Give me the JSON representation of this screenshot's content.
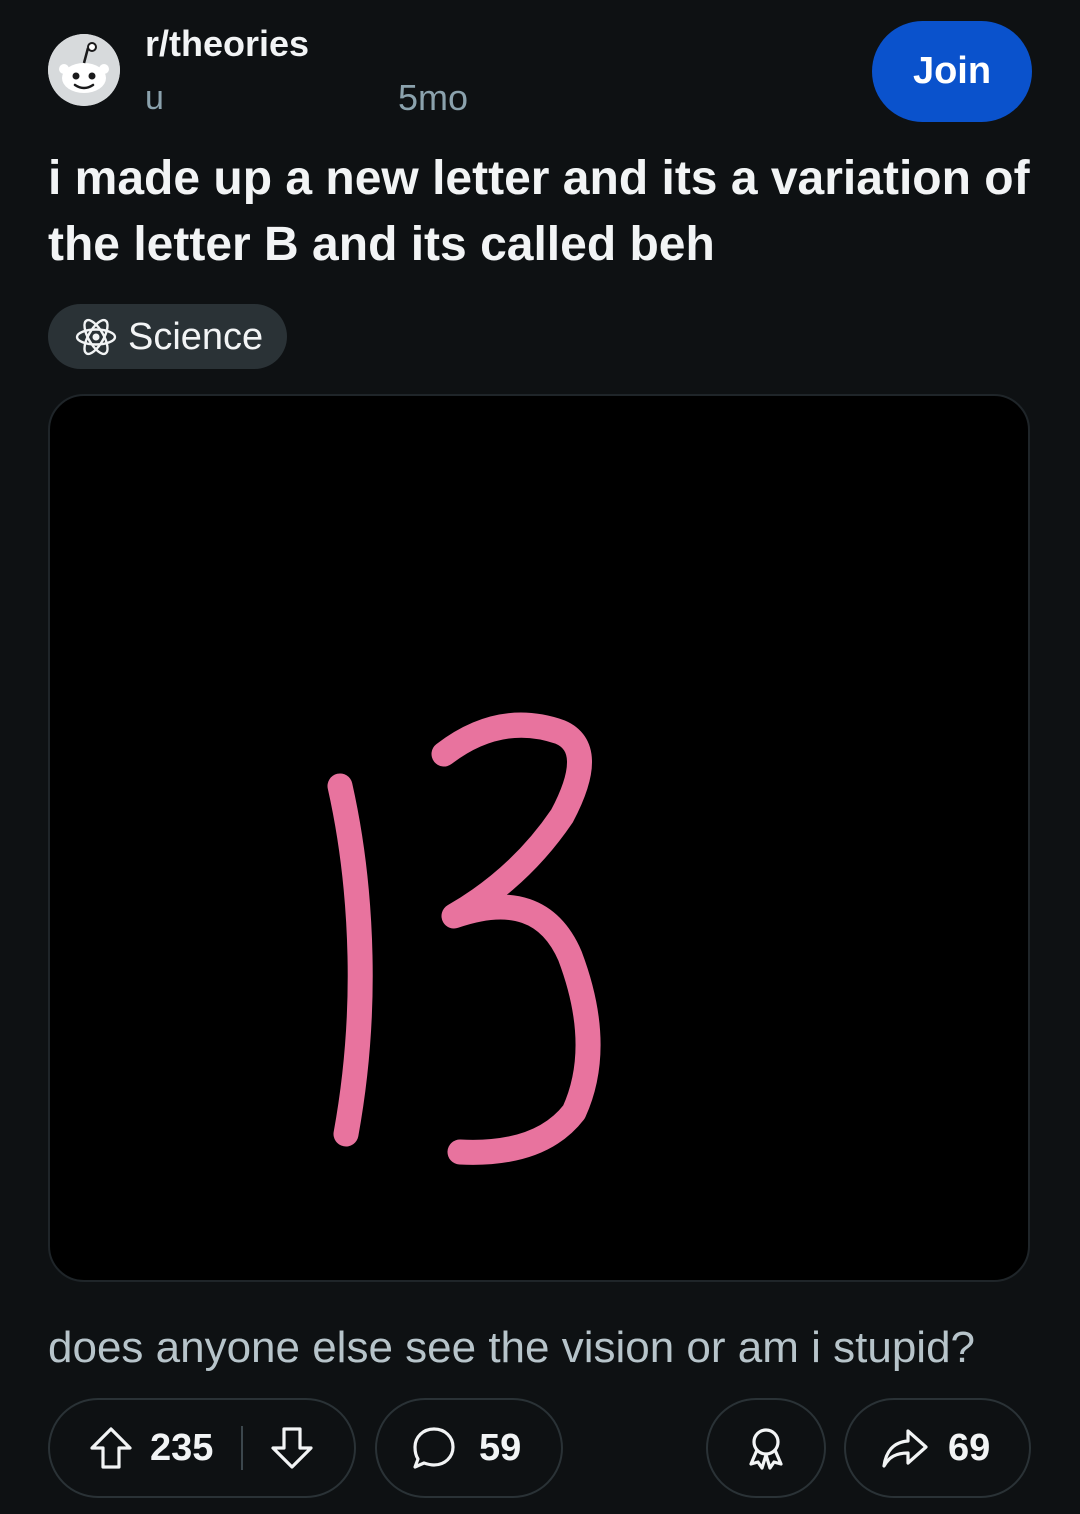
{
  "post": {
    "subreddit": "r/theories",
    "author_visible": "u",
    "age": "5mo",
    "join_label": "Join",
    "title": "i made up a new letter and its a variation of the letter B and its called beh",
    "flair": {
      "label": "Science",
      "icon": "atom-icon"
    },
    "image": {
      "description_icon": "handwritten-beh-letter",
      "stroke_color": "#e8739e",
      "background_color": "#000000"
    },
    "body": "does anyone else see the vision or am i stupid?"
  },
  "actions": {
    "upvote_icon": "upvote-arrow-icon",
    "score": "235",
    "downvote_icon": "downvote-arrow-icon",
    "comment_icon": "comment-bubble-icon",
    "comments": "59",
    "award_icon": "award-icon",
    "share_icon": "share-arrow-icon",
    "shares": "69"
  },
  "theme": {
    "background": "#0e1113",
    "accent": "#0a52cc",
    "pill": "#2a3236",
    "muted_text": "#8ba2ad"
  }
}
